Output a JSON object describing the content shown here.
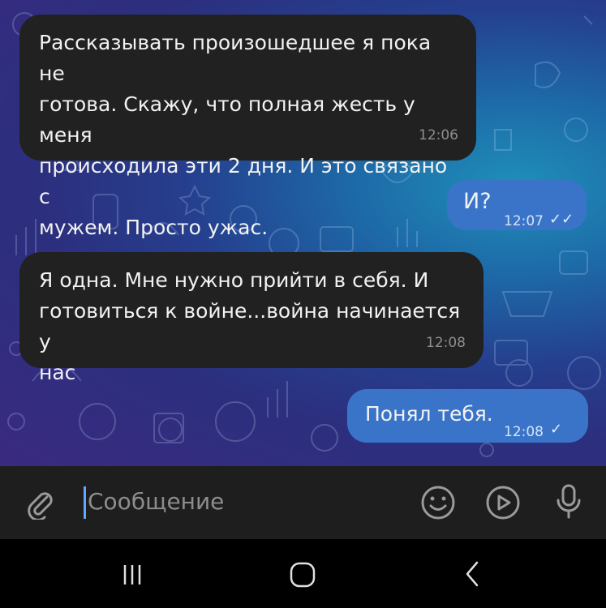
{
  "messages": [
    {
      "direction": "incoming",
      "text": "Рассказывать произошедшее я пока не\nготова. Скажу, что полная жесть у меня\nпроисходила эти 2 дня. И это связано с\nмужем. Просто ужас.",
      "time": "12:06"
    },
    {
      "direction": "outgoing",
      "text": "И?",
      "time": "12:07",
      "status": "read"
    },
    {
      "direction": "incoming",
      "text": "Я одна. Мне нужно прийти в себя. И\nготовиться к войне...война начинается у\nнас",
      "time": "12:08"
    },
    {
      "direction": "outgoing",
      "text": "Понял тебя.",
      "time": "12:08",
      "status": "sent"
    }
  ],
  "composer": {
    "placeholder": "Сообщение"
  },
  "icons": {
    "attach": "paperclip-icon",
    "emoji": "emoji-icon",
    "gif": "play-icon",
    "mic": "microphone-icon",
    "recents": "recents-icon",
    "home": "home-icon",
    "back": "back-icon"
  },
  "colors": {
    "incoming_bubble": "#212121",
    "outgoing_bubble": "#3a74c9",
    "composer_bg": "#1e1e1e",
    "cursor": "#5fa8ff"
  }
}
